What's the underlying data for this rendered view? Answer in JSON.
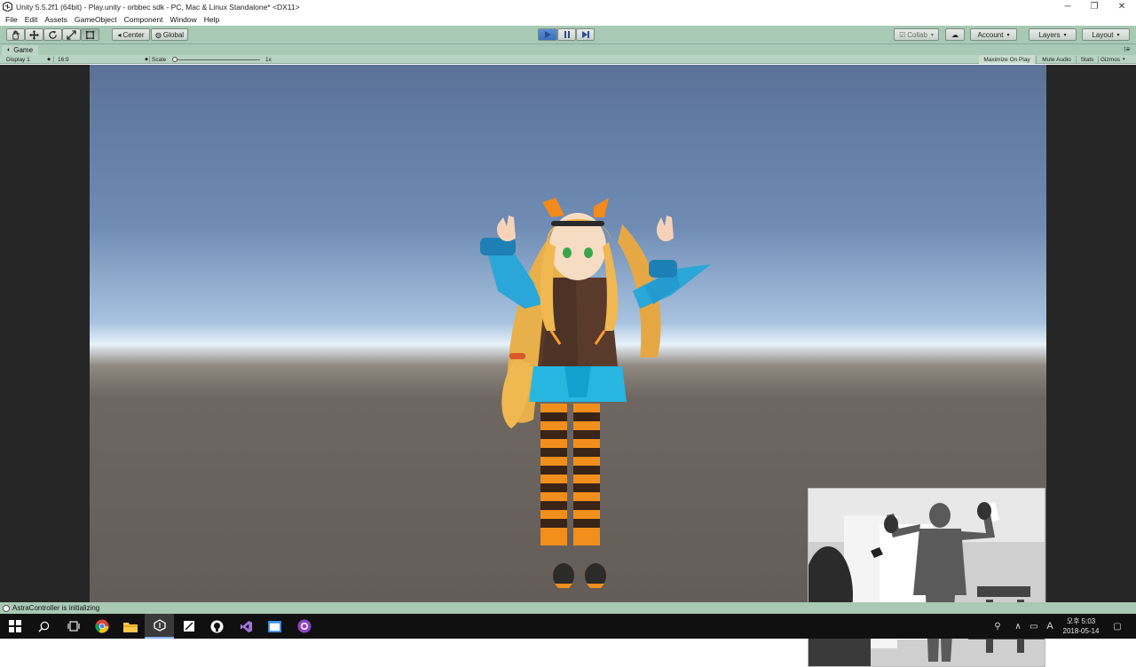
{
  "window": {
    "title": "Unity 5.5.2f1 (64bit) - Play.unity - orbbec sdk - PC, Mac & Linux Standalone* <DX11>",
    "controls": [
      "minimize-icon",
      "restore-icon",
      "close-icon"
    ]
  },
  "menu": [
    "File",
    "Edit",
    "Assets",
    "GameObject",
    "Component",
    "Window",
    "Help"
  ],
  "toolbar": {
    "tools": [
      "hand-icon",
      "move-icon",
      "rotate-icon",
      "scale-icon",
      "rect-icon"
    ],
    "pivot_label": "Center",
    "space_label": "Global",
    "play_state": "playing",
    "collab_label": "Collab",
    "account_label": "Account",
    "layers_label": "Layers",
    "layout_label": "Layout"
  },
  "game_view": {
    "tab_label": "Game",
    "display_label": "Display 1",
    "aspect_label": "16:9",
    "scale_label": "Scale",
    "scale_value_label": "1x",
    "scale_value": 1,
    "maximize_label": "Maximize On Play",
    "mute_label": "Mute Audio",
    "stats_label": "Stats",
    "gizmos_label": "Gizmos"
  },
  "status": {
    "message": "AstraController is initializing"
  },
  "taskbar": {
    "apps": [
      "start-icon",
      "search-icon",
      "task-view-icon",
      "chrome-icon",
      "file-explorer-icon",
      "unity-icon",
      "sticky-app-icon",
      "github-icon",
      "visual-studio-icon",
      "app-window-icon",
      "purple-app-icon"
    ],
    "ime_label": "A",
    "clock_ampm": "오후 5:03",
    "clock_date": "2018-05-14"
  },
  "colors": {
    "editor_tint": "#a8c9b4",
    "play_blue": "#3b6fc0",
    "taskbar": "#101010"
  }
}
